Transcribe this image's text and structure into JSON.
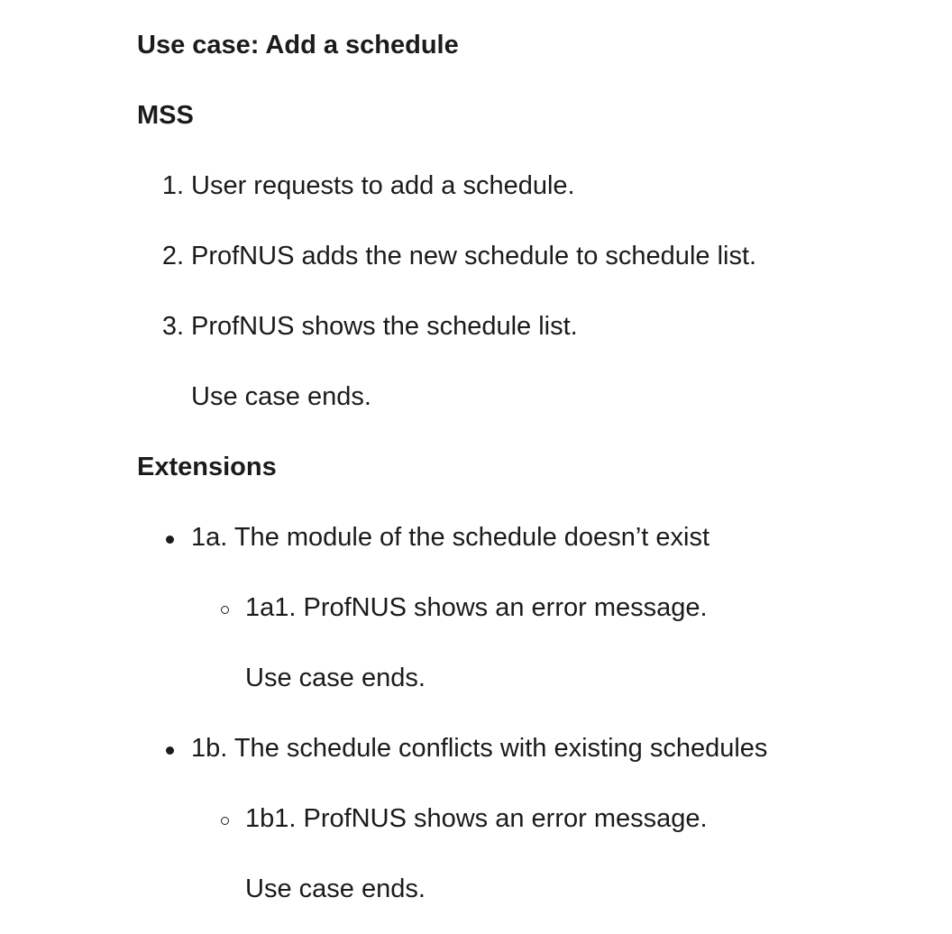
{
  "title": "Use case: Add a schedule",
  "mss": {
    "heading": "MSS",
    "steps": [
      {
        "number": "1.",
        "text": "User requests to add a schedule."
      },
      {
        "number": "2.",
        "text": "ProfNUS adds the new schedule to schedule list."
      },
      {
        "number": "3.",
        "text": "ProfNUS shows the schedule list."
      }
    ],
    "ending": "Use case ends."
  },
  "extensions": {
    "heading": "Extensions",
    "items": [
      {
        "text": "1a. The module of the schedule doesn’t exist",
        "sub": {
          "text": "1a1. ProfNUS shows an error message.",
          "ending": "Use case ends."
        }
      },
      {
        "text": "1b. The schedule conflicts with existing schedules",
        "sub": {
          "text": "1b1. ProfNUS shows an error message.",
          "ending": "Use case ends."
        }
      }
    ]
  }
}
